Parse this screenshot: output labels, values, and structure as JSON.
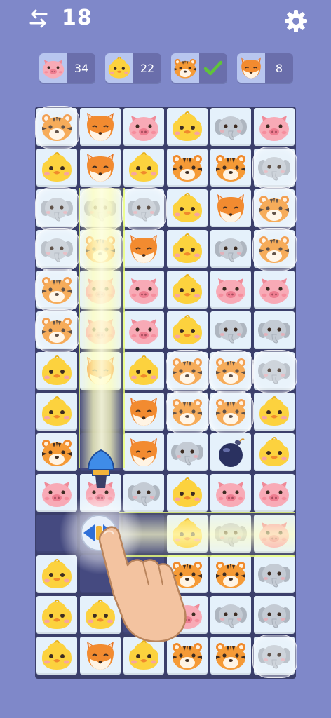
{
  "header": {
    "moves": "18",
    "moves_icon": "swap-arrows-icon",
    "settings_icon": "gear-icon"
  },
  "goals": [
    {
      "animal": "pig",
      "count": "34",
      "done": false
    },
    {
      "animal": "chick",
      "count": "22",
      "done": false
    },
    {
      "animal": "tiger",
      "count": "",
      "done": true
    },
    {
      "animal": "fox",
      "count": "8",
      "done": false
    }
  ],
  "colors": {
    "background": "#7f88c9",
    "tile": "#e5f1fb",
    "goal_count_bg": "#6a6eab",
    "check": "#5fc43a"
  },
  "board": {
    "rows": [
      [
        "tiger",
        "fox",
        "pig",
        "chick",
        "elephant",
        "pig"
      ],
      [
        "chick",
        "fox",
        "chick",
        "tiger",
        "tiger",
        "elephant"
      ],
      [
        "elephant",
        "elephant",
        "elephant",
        "chick",
        "fox",
        "tiger"
      ],
      [
        "elephant",
        "tiger",
        "fox",
        "chick",
        "elephant",
        "tiger"
      ],
      [
        "tiger",
        "pig",
        "pig",
        "chick",
        "pig",
        "pig"
      ],
      [
        "tiger",
        "pig",
        "pig",
        "chick",
        "elephant",
        "elephant"
      ],
      [
        "chick",
        "fox",
        "chick",
        "tiger",
        "tiger",
        "elephant"
      ],
      [
        "chick",
        "",
        "fox",
        "tiger",
        "tiger",
        "chick"
      ],
      [
        "tiger",
        "",
        "fox",
        "elephant",
        "bomb",
        "chick"
      ],
      [
        "pig",
        "pig",
        "elephant",
        "chick",
        "pig",
        "pig"
      ],
      [
        "",
        "",
        "",
        "chick",
        "elephant",
        "pig"
      ],
      [
        "chick",
        "",
        "",
        "tiger",
        "tiger",
        "elephant"
      ],
      [
        "chick",
        "chick",
        "",
        "pig",
        "elephant",
        "elephant"
      ],
      [
        "chick",
        "fox",
        "chick",
        "tiger",
        "tiger",
        "elephant"
      ]
    ],
    "bubbles": [
      [
        0,
        0
      ],
      [
        1,
        5
      ],
      [
        2,
        0
      ],
      [
        2,
        1
      ],
      [
        2,
        2
      ],
      [
        2,
        5
      ],
      [
        3,
        0
      ],
      [
        3,
        1
      ],
      [
        3,
        5
      ],
      [
        4,
        0
      ],
      [
        5,
        0
      ],
      [
        6,
        3
      ],
      [
        6,
        4
      ],
      [
        6,
        5
      ],
      [
        7,
        3
      ],
      [
        7,
        4
      ],
      [
        13,
        5
      ]
    ]
  },
  "powerups": {
    "rocket": "rocket-icon",
    "direction_button": "direction-arrows-icon",
    "tutorial_hand": "pointing-hand-icon"
  }
}
